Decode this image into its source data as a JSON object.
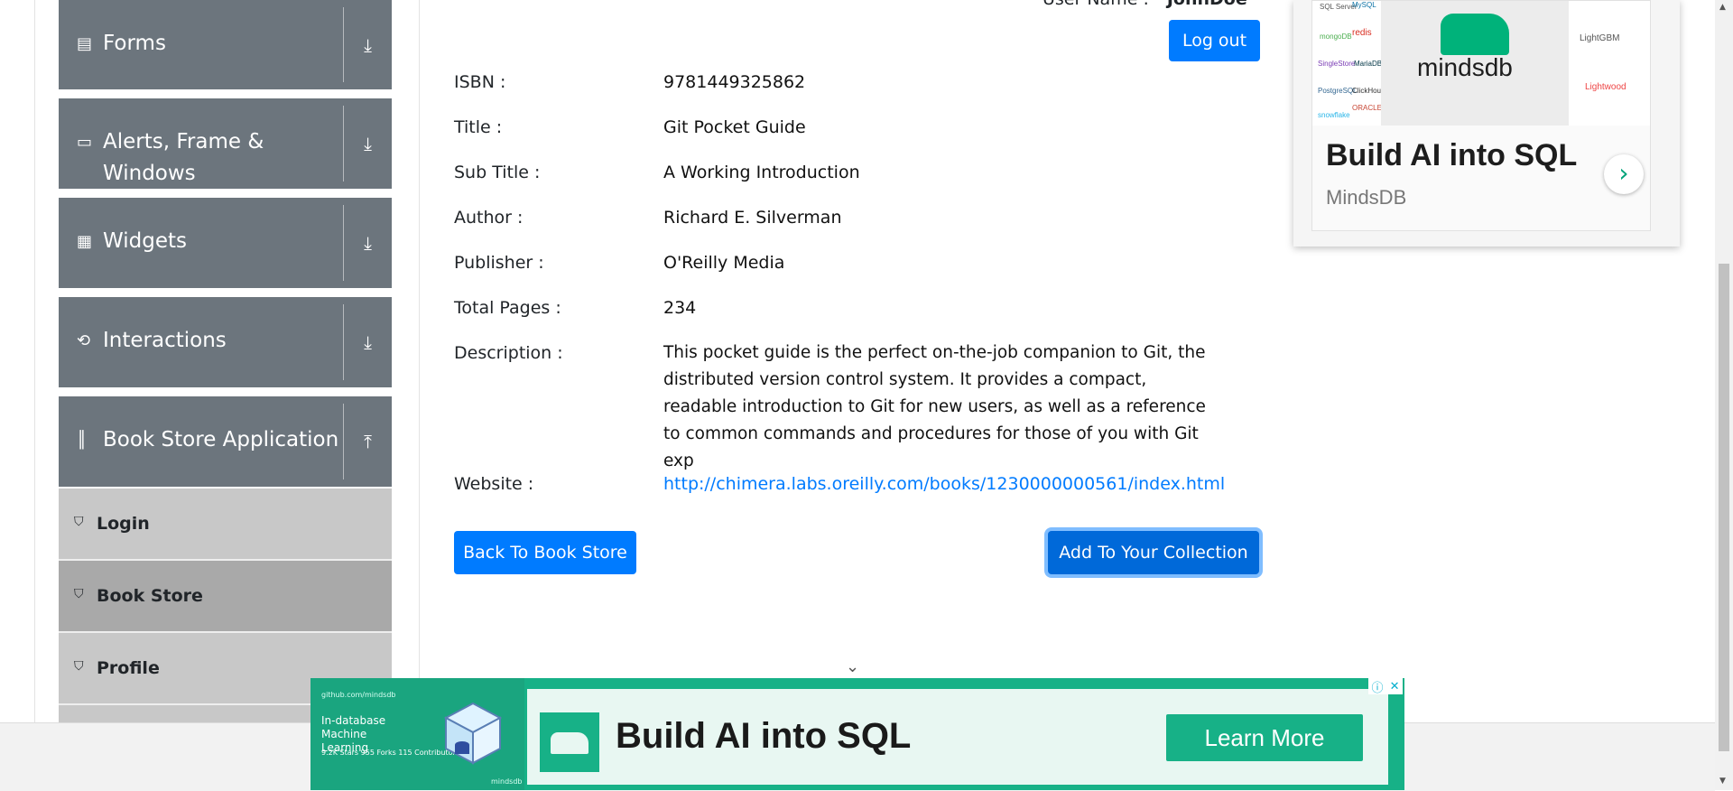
{
  "sidebar": {
    "groups": [
      {
        "label": "Forms",
        "icon": "form-icon",
        "toggle": "download-arrow-icon"
      },
      {
        "label": "Alerts, Frame & Windows",
        "icon": "window-icon",
        "toggle": "download-arrow-icon"
      },
      {
        "label": "Widgets",
        "icon": "widgets-icon",
        "toggle": "download-arrow-icon"
      },
      {
        "label": "Interactions",
        "icon": "interactions-icon",
        "toggle": "download-arrow-icon"
      },
      {
        "label": "Book Store Application",
        "icon": "books-icon",
        "toggle": "upload-arrow-icon"
      }
    ],
    "subitems": [
      {
        "label": "Login",
        "icon": "html-shield-icon"
      },
      {
        "label": "Book Store",
        "icon": "html-shield-icon",
        "active": true
      },
      {
        "label": "Profile",
        "icon": "html-shield-icon"
      }
    ]
  },
  "header": {
    "user_name_label": "User Name :",
    "user_name_value": "JohnDoe",
    "logout_label": "Log out"
  },
  "book": {
    "fields": [
      {
        "label": "ISBN :",
        "value": "9781449325862"
      },
      {
        "label": "Title :",
        "value": "Git Pocket Guide"
      },
      {
        "label": "Sub Title :",
        "value": "A Working Introduction"
      },
      {
        "label": "Author :",
        "value": "Richard E. Silverman"
      },
      {
        "label": "Publisher :",
        "value": "O'Reilly Media"
      },
      {
        "label": "Total Pages :",
        "value": "234"
      },
      {
        "label": "Description :",
        "value": "This pocket guide is the perfect on-the-job companion to Git, the distributed version control system. It provides a compact, readable introduction to Git for new users, as well as a reference to common commands and procedures for those of you with Git exp"
      },
      {
        "label": "Website :",
        "value": "http://chimera.labs.oreilly.com/books/1230000000561/index.html"
      }
    ],
    "back_button": "Back To Book Store",
    "add_button": "Add To Your Collection"
  },
  "side_ad": {
    "title": "Build AI into SQL",
    "brand": "MindsDB",
    "hero_text": "mindsdb",
    "left_logos": [
      "SQL Server",
      "MySQL",
      "mongoDB",
      "redis",
      "SingleStore",
      "MariaDB",
      "PostgreSQL",
      "ClickHouse",
      "snowflake",
      "ORACLE"
    ],
    "right_logos": [
      "LightGBM",
      "Lightwood"
    ]
  },
  "bottom_ad": {
    "source": "github.com/mindsdb",
    "tagline": "In-database Machine Learning",
    "stats": [
      "9.2K Stars",
      "955 Forks",
      "115 Contributors"
    ],
    "headline": "Build AI into SQL",
    "cta": "Learn More",
    "small_brand": "mindsdb"
  },
  "colors": {
    "primary": "#007bff",
    "sidebar_group": "#6c757d",
    "sidebar_item": "#c8c8c8",
    "sidebar_item_active": "#a9a9a9",
    "ad_green": "#17b187"
  }
}
